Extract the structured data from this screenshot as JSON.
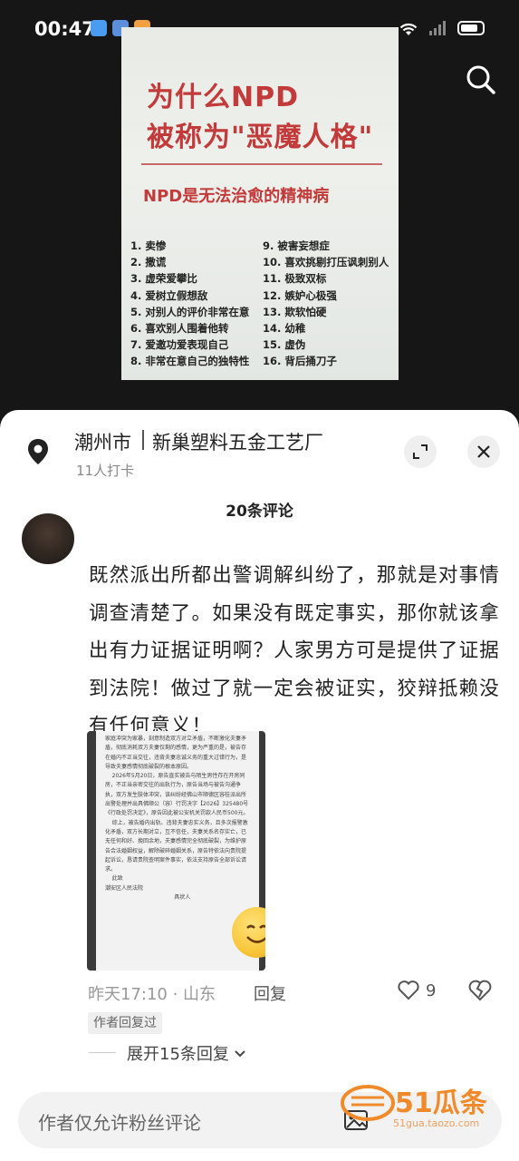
{
  "status_bar": {
    "time": "00:47"
  },
  "poster": {
    "title_line1": "为什么NPD",
    "title_line2": "被称为\"恶魔人格\"",
    "subtitle": "NPD是无法治愈的精神病",
    "items_left": [
      "1. 卖惨",
      "2. 撒谎",
      "3. 虚荣爱攀比",
      "4. 爱树立假想敌",
      "5. 对别人的评价非常在意",
      "6. 喜欢别人围着他转",
      "7. 爱邀功爱表现自己",
      "8. 非常在意自己的独特性"
    ],
    "items_right": [
      "9. 被害妄想症",
      "10. 喜欢挑剔打压讽刺别人",
      "11. 极致双标",
      "12. 嫉妒心极强",
      "13. 欺软怕硬",
      "14. 幼稚",
      "15. 虚伪",
      "16. 背后捅刀子"
    ]
  },
  "location": {
    "city": "潮州市",
    "name": "新巢塑料五金工艺厂",
    "checkins": "11人打卡"
  },
  "comments_header": "20条评论",
  "comment": {
    "text": "既然派出所都出警调解纠纷了，那就是对事情调查清楚了。如果没有既定事实，那你就该拿出有力证据证明啊？人家男方可是提供了证据到法院！做过了就一定会被证实，狡辩抵赖没有任何意义！",
    "image_text": "家庭冲突为家暴，刻意制造双方对立矛盾，不断激化夫妻矛盾，彻底消耗双方夫妻仅剩的感情，更为严重的是，被告存在婚内不正当交往，违背夫妻忠诚义务的重大过错行为，是导致夫妻感情彻底破裂的根本原因。\n    2026年5月20日，原告直实被告与陌生男性存在开房同房，不正当亲密交往的出轨行为，原告当场与被告沟通争执，双方发生肢体冲突，该纠纷经佛山市顺德区容桂派出所出警处理并出具佛顺公（容）行罚决字【2026】325480号《行政处罚决定》，原告因此被公安机关罚款人民币500元。\n    综上，被告婚内出轨、违背夫妻忠实义务，且多次报警激化矛盾，双方长期对立，互不信任，夫妻关系名存实亡，已无任何和好、挽回余地，夫妻感情完全彻底破裂，为维护原告合法婚姻权益，解除破碎婚姻关系，原告特依法向贵院提起诉讼，恳请贵院查明案件事实，依法支持原告全部诉讼请求。\n    此致\n潮安区人民法院\n                                        具状人",
    "time_location": "昨天17:10 · 山东",
    "reply_label": "回复",
    "likes": "9",
    "author_badge": "作者回复过",
    "expand_label": "展开15条回复"
  },
  "input": {
    "placeholder": "作者仅允许粉丝评论"
  },
  "watermark": {
    "brand": "51瓜条",
    "url": "51gua.taozo.com"
  },
  "colors": {
    "poster_red": "#c23a3a",
    "sheet_bg": "#ffffff",
    "page_bg": "#161616",
    "watermark_orange": "#f08a2a"
  }
}
